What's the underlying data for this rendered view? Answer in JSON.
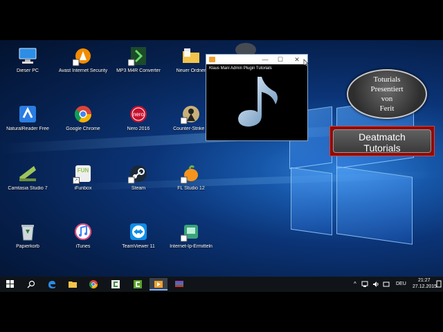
{
  "desktop": {
    "icons": [
      {
        "label": "Dieser PC",
        "icon": "computer-icon"
      },
      {
        "label": "Avast Internet Security",
        "icon": "avast-icon"
      },
      {
        "label": "MP3 M4R Converter",
        "icon": "converter-icon"
      },
      {
        "label": "Neuer Ordner",
        "icon": "folder-icon"
      },
      {
        "label": "NaturalReader Free",
        "icon": "naturalreader-icon"
      },
      {
        "label": "Google Chrome",
        "icon": "chrome-icon"
      },
      {
        "label": "Nero 2016",
        "icon": "nero-icon"
      },
      {
        "label": "Counter-Strike S",
        "icon": "counter-strike-icon"
      },
      {
        "label": "Camtasia Studio 7",
        "icon": "camtasia-icon"
      },
      {
        "label": "iFunbox",
        "icon": "ifunbox-icon"
      },
      {
        "label": "Steam",
        "icon": "steam-icon"
      },
      {
        "label": "FL Studio 12",
        "icon": "fl-studio-icon"
      },
      {
        "label": "Papierkorb",
        "icon": "recycle-bin-icon"
      },
      {
        "label": "iTunes",
        "icon": "itunes-icon"
      },
      {
        "label": "TeamViewer 11",
        "icon": "teamviewer-icon"
      },
      {
        "label": "Internet-Ip-Ermitteln",
        "icon": "network-icon"
      }
    ],
    "ifunbox_badge": "FUN"
  },
  "media_window": {
    "title": "Klaus Mani Admin Plugin Tutorials",
    "controls": {
      "minimize": "—",
      "maximize": "☐",
      "close": "✕"
    }
  },
  "overlay": {
    "circle_lines": [
      "Toturials",
      "Presentiert",
      "von",
      "Ferit"
    ],
    "box_lines": [
      "Deatmatch",
      "Tutorials"
    ]
  },
  "taskbar": {
    "pinned": [
      "start-icon",
      "search-icon",
      "edge-icon",
      "explorer-icon",
      "chrome-icon",
      "camtasia-icon",
      "camtasia-recorder-icon",
      "media-player-icon",
      "winrar-icon"
    ],
    "tray": {
      "chevron": "^",
      "language": "DEU",
      "time": "21:27",
      "date": "27.12.2015"
    }
  },
  "colors": {
    "accent": "#1656a8",
    "overlay_red": "#8f0b0b",
    "taskbar": "#101418"
  }
}
